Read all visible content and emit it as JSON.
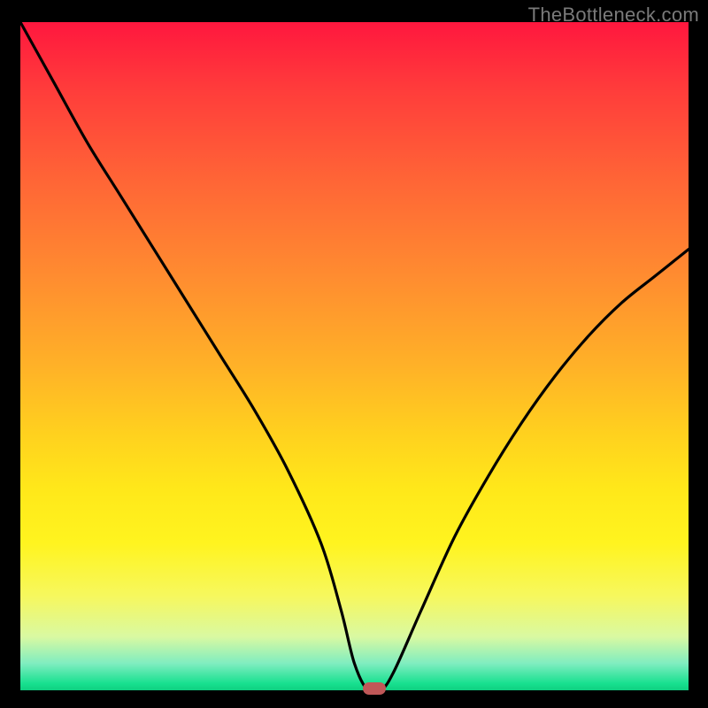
{
  "watermark": "TheBottleneck.com",
  "chart_data": {
    "type": "line",
    "title": "",
    "xlabel": "",
    "ylabel": "",
    "xlim": [
      0,
      100
    ],
    "ylim": [
      0,
      100
    ],
    "series": [
      {
        "name": "bottleneck-curve",
        "x": [
          0,
          5,
          10,
          15,
          20,
          25,
          30,
          35,
          40,
          45,
          48,
          50,
          52,
          54,
          56,
          60,
          65,
          70,
          75,
          80,
          85,
          90,
          95,
          100
        ],
        "values": [
          100,
          91,
          82,
          74,
          66,
          58,
          50,
          42,
          33,
          22,
          12,
          4,
          0,
          0,
          3,
          12,
          23,
          32,
          40,
          47,
          53,
          58,
          62,
          66
        ]
      }
    ],
    "gradient_stops": [
      {
        "pct": 0,
        "color": "#ff173e"
      },
      {
        "pct": 10,
        "color": "#ff3c3b"
      },
      {
        "pct": 24,
        "color": "#ff6636"
      },
      {
        "pct": 38,
        "color": "#ff8c30"
      },
      {
        "pct": 52,
        "color": "#ffb327"
      },
      {
        "pct": 62,
        "color": "#ffd21e"
      },
      {
        "pct": 70,
        "color": "#ffe81a"
      },
      {
        "pct": 78,
        "color": "#fff41f"
      },
      {
        "pct": 86,
        "color": "#f6f85f"
      },
      {
        "pct": 92,
        "color": "#d9f9a2"
      },
      {
        "pct": 96,
        "color": "#7fedc0"
      },
      {
        "pct": 99,
        "color": "#17e08f"
      },
      {
        "pct": 100,
        "color": "#0fcf80"
      }
    ],
    "marker": {
      "x": 53,
      "y": 0,
      "color": "#c05858"
    }
  },
  "colors": {
    "frame": "#000000",
    "curve": "#000000",
    "marker": "#c05858",
    "watermark": "#7a7a7a"
  }
}
